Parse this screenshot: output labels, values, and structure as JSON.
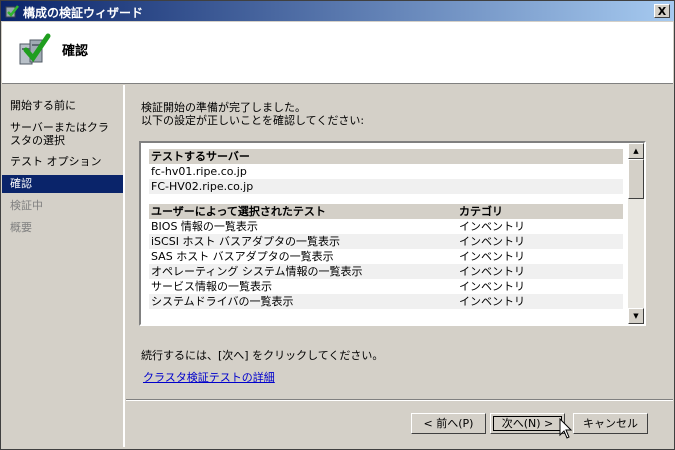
{
  "window": {
    "title": "構成の検証ウィザード",
    "close_label": "X"
  },
  "header": {
    "title": "確認"
  },
  "nav": {
    "items": [
      {
        "label": "開始する前に",
        "state": "normal"
      },
      {
        "label": "サーバーまたはクラスタの選択",
        "state": "normal"
      },
      {
        "label": "テスト オプション",
        "state": "normal"
      },
      {
        "label": "確認",
        "state": "active"
      },
      {
        "label": "検証中",
        "state": "disabled"
      },
      {
        "label": "概要",
        "state": "disabled"
      }
    ]
  },
  "content": {
    "intro_line1": "検証開始の準備が完了しました。",
    "intro_line2": "以下の設定が正しいことを確認してください:",
    "servers_header": "テストするサーバー",
    "servers": [
      "fc-hv01.ripe.co.jp",
      "FC-HV02.ripe.co.jp"
    ],
    "tests_header": "ユーザーによって選択されたテスト",
    "category_header": "カテゴリ",
    "tests": [
      {
        "name": "BIOS 情報の一覧表示",
        "category": "インベントリ"
      },
      {
        "name": "iSCSI ホスト バスアダプタの一覧表示",
        "category": "インベントリ"
      },
      {
        "name": "SAS ホスト バスアダプタの一覧表示",
        "category": "インベントリ"
      },
      {
        "name": "オペレーティング システム情報の一覧表示",
        "category": "インベントリ"
      },
      {
        "name": "サービス情報の一覧表示",
        "category": "インベントリ"
      },
      {
        "name": "システムドライバの一覧表示",
        "category": "インベントリ"
      }
    ],
    "continue_text": "続行するには、[次へ] をクリックしてください。",
    "details_link": "クラスタ検証テストの詳細"
  },
  "buttons": {
    "back": "< 前へ(P)",
    "next": "次へ(N) >",
    "cancel": "キャンセル"
  },
  "colors": {
    "title_start": "#0a246a",
    "title_end": "#a6caf0",
    "selection": "#0a246a",
    "face": "#d4d0c8",
    "link": "#0000cc"
  }
}
